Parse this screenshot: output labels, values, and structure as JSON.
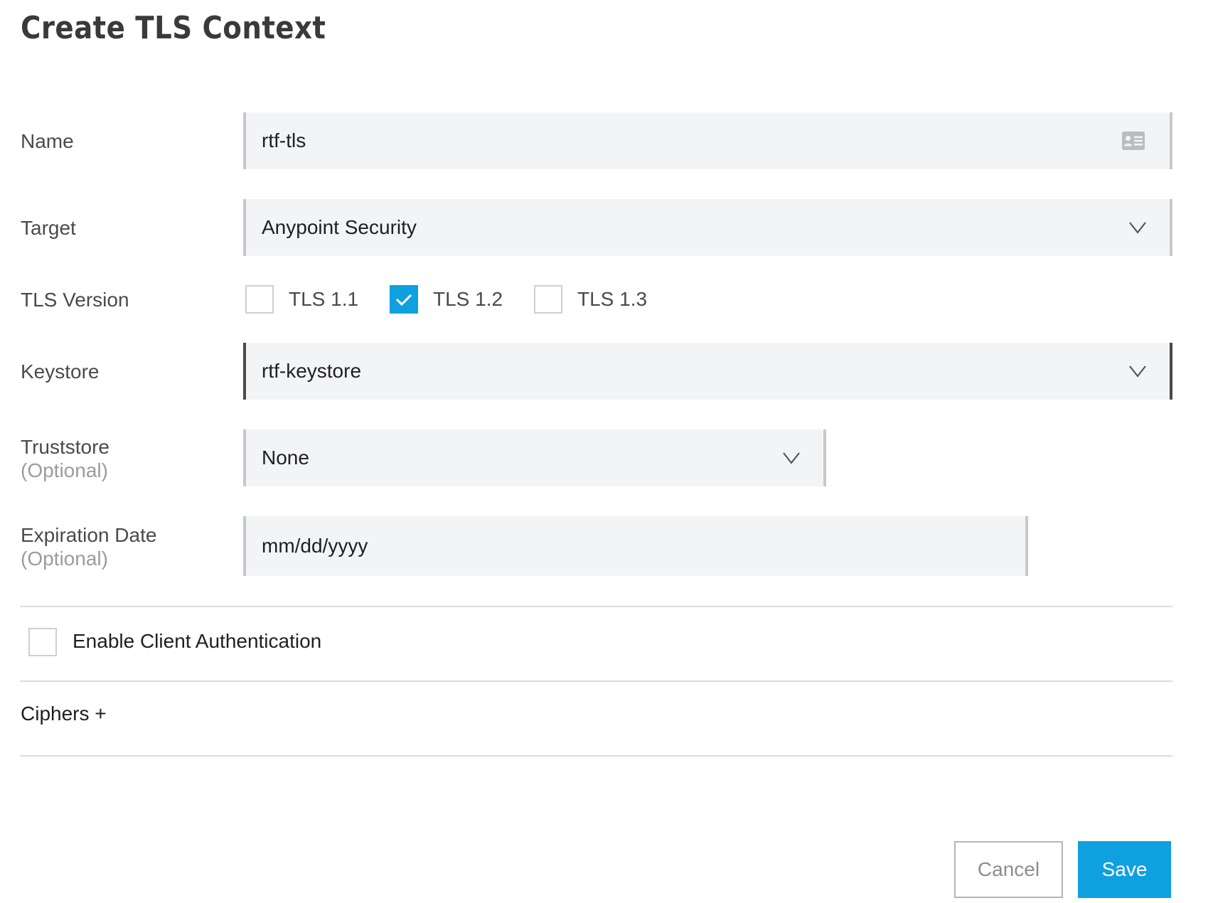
{
  "page": {
    "title": "Create TLS Context"
  },
  "form": {
    "name": {
      "label": "Name",
      "value": "rtf-tls",
      "icon": "contact-card-icon"
    },
    "target": {
      "label": "Target",
      "value": "Anypoint Security",
      "icon": "chevron-down-icon"
    },
    "tls_version": {
      "label": "TLS Version",
      "options": [
        {
          "label": "TLS 1.1",
          "checked": false
        },
        {
          "label": "TLS 1.2",
          "checked": true
        },
        {
          "label": "TLS 1.3",
          "checked": false
        }
      ]
    },
    "keystore": {
      "label": "Keystore",
      "value": "rtf-keystore",
      "icon": "chevron-down-icon"
    },
    "truststore": {
      "label": "Truststore",
      "optional": "(Optional)",
      "value": "None",
      "icon": "chevron-down-icon"
    },
    "expiration_date": {
      "label": "Expiration Date",
      "optional": "(Optional)",
      "placeholder": "mm/dd/yyyy"
    },
    "client_auth": {
      "label": "Enable Client Authentication",
      "checked": false
    },
    "ciphers": {
      "label": "Ciphers +"
    }
  },
  "actions": {
    "cancel_label": "Cancel",
    "save_label": "Save"
  },
  "colors": {
    "accent": "#0fa0e0",
    "field_bg": "#f3f4f6",
    "divider": "#dcdcdc"
  }
}
